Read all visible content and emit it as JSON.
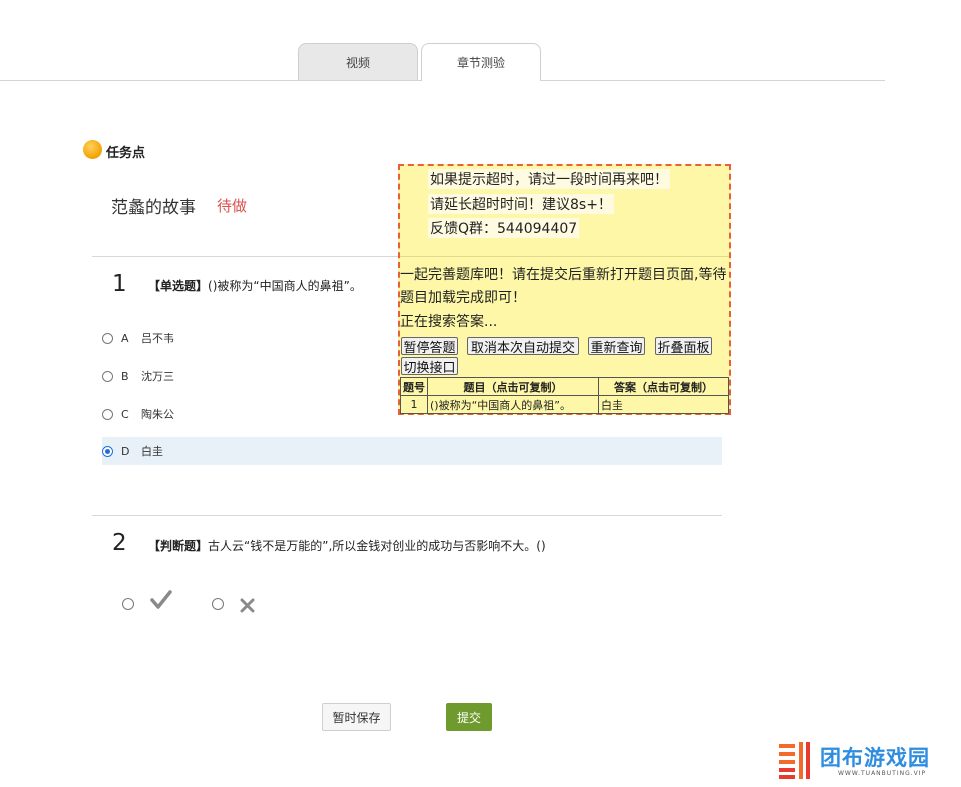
{
  "tabs": [
    {
      "label": "视频"
    },
    {
      "label": "章节测验"
    }
  ],
  "task_point": {
    "label": "任务点"
  },
  "story": {
    "title": "范蠡的故事",
    "status": "待做"
  },
  "questions": [
    {
      "number": "1",
      "type": "【单选题】",
      "text": "()被称为“中国商人的鼻祖”。",
      "options": [
        {
          "letter": "A",
          "text": "吕不韦"
        },
        {
          "letter": "B",
          "text": "沈万三"
        },
        {
          "letter": "C",
          "text": "陶朱公"
        },
        {
          "letter": "D",
          "text": "白圭"
        }
      ],
      "selected": "D"
    },
    {
      "number": "2",
      "type": "【判断题】",
      "text": "古人云“钱不是万能的”,所以金钱对创业的成功与否影响不大。()",
      "true_icon": "check-icon",
      "false_icon": "cross-icon"
    }
  ],
  "buttons": {
    "save": "暂时保存",
    "submit": "提交"
  },
  "panel": {
    "tips": [
      "如果提示超时，请过一段时间再来吧！",
      "请延长超时时间！建议8s+！",
      "反馈Q群：544094407"
    ],
    "message1": "一起完善题库吧！请在提交后重新打开题目页面,等待题目加载完成即可！",
    "message2": "正在搜索答案...",
    "buttons": [
      "暂停答题",
      "取消本次自动提交",
      "重新查询",
      "折叠面板",
      "切换接口"
    ],
    "table": {
      "headers": [
        "题号",
        "题目（点击可复制）",
        "答案（点击可复制）"
      ],
      "rows": [
        {
          "num": "1",
          "question": "()被称为“中国商人的鼻祖”。",
          "answer": "白圭"
        }
      ]
    }
  },
  "watermark": {
    "text": "团布游戏园",
    "sub": "WWW.TUANBUTING.VIP"
  },
  "colors": {
    "status_red": "#d9534f",
    "submit_green": "#6f9a2e",
    "panel_yellow": "#fdf7a7",
    "panel_border": "#e8603a",
    "selected_blue": "#1f6fd6"
  }
}
